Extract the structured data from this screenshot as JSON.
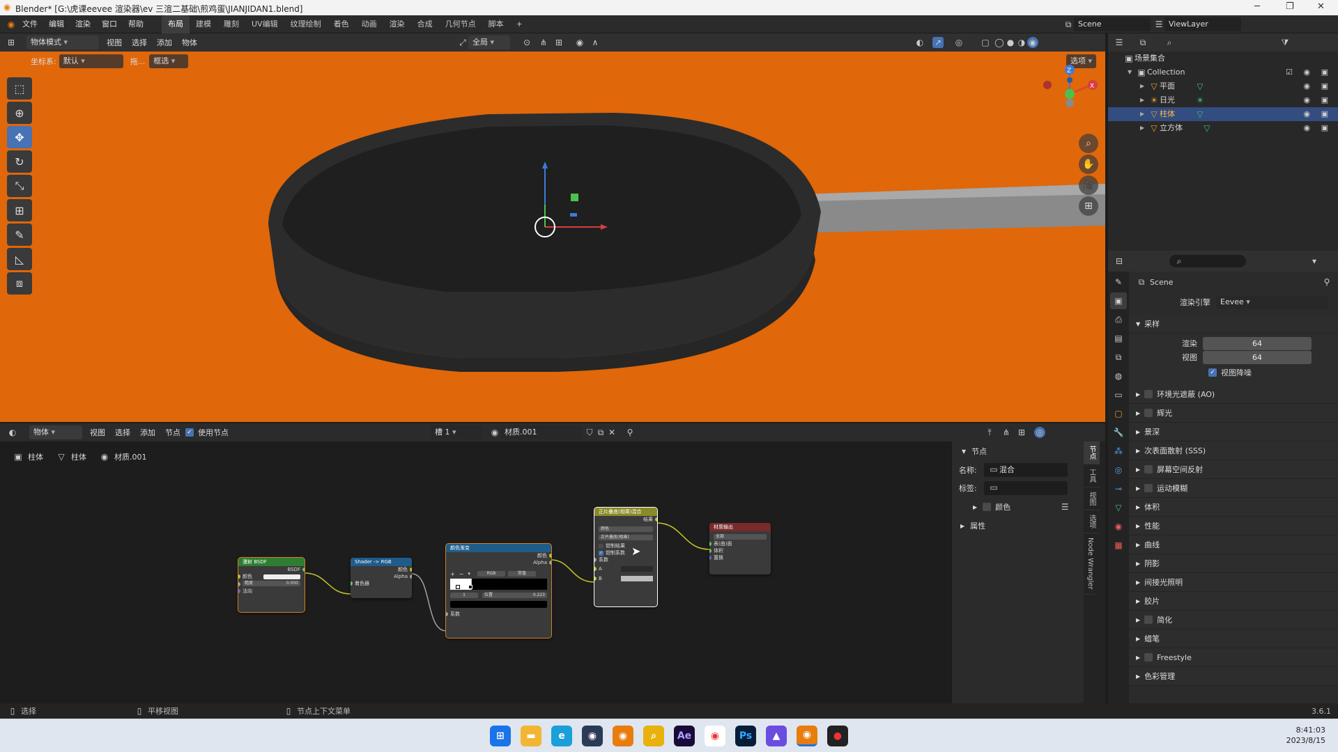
{
  "window": {
    "title": "Blender* [G:\\虎课eevee 渲染器\\ev 三渲二基础\\煎鸡蛋\\JIANJIDAN1.blend]",
    "min": "─",
    "max": "❐",
    "close": "✕"
  },
  "topbar": {
    "menus": [
      "文件",
      "编辑",
      "渲染",
      "窗口",
      "帮助"
    ],
    "workspaces": [
      "布局",
      "建模",
      "雕刻",
      "UV编辑",
      "纹理绘制",
      "着色",
      "动画",
      "渲染",
      "合成",
      "几何节点",
      "脚本"
    ],
    "active_workspace": "布局",
    "add_tab": "+",
    "scene": "Scene",
    "view_layer": "ViewLayer"
  },
  "viewport_header": {
    "mode": "物体模式",
    "menus": [
      "视图",
      "选择",
      "添加",
      "物体"
    ],
    "transform_orientation": "全局",
    "coord_label": "坐标系:",
    "coord_value": "默认",
    "drag_label": "拖...",
    "drag_value": "框选",
    "options": "选项"
  },
  "outliner": {
    "root": "场景集合",
    "collection": "Collection",
    "items": [
      {
        "name": "平面",
        "selected": false
      },
      {
        "name": "日光",
        "selected": false
      },
      {
        "name": "柱体",
        "selected": true
      },
      {
        "name": "立方体",
        "selected": false
      }
    ]
  },
  "properties": {
    "scene_name": "Scene",
    "render_engine_label": "渲染引擎",
    "render_engine": "Eevee",
    "sampling_title": "采样",
    "render_label": "渲染",
    "render_value": "64",
    "viewport_label": "视图",
    "viewport_value": "64",
    "viewport_denoise": "视图降噪",
    "panels": [
      {
        "label": "环境光遮蔽 (AO)",
        "checkbox": true
      },
      {
        "label": "辉光",
        "checkbox": true
      },
      {
        "label": "景深",
        "checkbox": false
      },
      {
        "label": "次表面散射 (SSS)",
        "checkbox": false
      },
      {
        "label": "屏幕空间反射",
        "checkbox": true
      },
      {
        "label": "运动模糊",
        "checkbox": true
      },
      {
        "label": "体积",
        "checkbox": false
      },
      {
        "label": "性能",
        "checkbox": false
      },
      {
        "label": "曲线",
        "checkbox": false
      },
      {
        "label": "阴影",
        "checkbox": false
      },
      {
        "label": "间接光照明",
        "checkbox": false
      },
      {
        "label": "胶片",
        "checkbox": false
      },
      {
        "label": "简化",
        "checkbox": true
      },
      {
        "label": "蜡笔",
        "checkbox": false
      },
      {
        "label": "Freestyle",
        "checkbox": true
      },
      {
        "label": "色彩管理",
        "checkbox": false
      }
    ]
  },
  "node_header": {
    "object_mode": "物体",
    "menus": [
      "视图",
      "选择",
      "添加",
      "节点"
    ],
    "use_nodes": "使用节点",
    "slot": "槽 1",
    "material": "材质.001"
  },
  "breadcrumb": [
    "柱体",
    "柱体",
    "材质.001"
  ],
  "n_panel": {
    "section": "节点",
    "name_label": "名称:",
    "name_value": "混合",
    "label_label": "标签:",
    "label_value": "",
    "color": "颜色",
    "properties": "属性",
    "tabs": [
      "节点",
      "工具",
      "视图",
      "选项",
      "Node Wrangler"
    ]
  },
  "nodes": {
    "diffuse": {
      "title": "漫射 BSDF",
      "out": "BSDF",
      "color": "颜色",
      "roughness": "糙度",
      "roughness_value": "0.000",
      "normal": "法向"
    },
    "s2rgb": {
      "title": "Shader -> RGB",
      "color": "颜色",
      "alpha": "Alpha",
      "shader": "着色器"
    },
    "ramp": {
      "title": "颜色渐变",
      "color": "颜色",
      "alpha": "Alpha",
      "mode": "RGB",
      "interp": "常值",
      "index": "1",
      "pos_label": "位置",
      "pos_value": "0.223",
      "fac": "系数"
    },
    "mix": {
      "title": "正片叠底(相乘)混合",
      "result": "结果",
      "type": "颜色",
      "blend": "正片叠底(相乘)",
      "clamp_result": "钳制结果",
      "clamp_factor": "钳制系数",
      "fac": "系数",
      "a": "A",
      "b": "B"
    },
    "output": {
      "title": "材质输出",
      "target": "全部",
      "surface": "表(曲)面",
      "volume": "体积",
      "displacement": "置换"
    }
  },
  "statusbar": {
    "select": "选择",
    "pan": "平移视图",
    "context": "节点上下文菜单",
    "version": "3.6.1"
  },
  "taskbar": {
    "time": "8:41:03",
    "date": "2023/8/15",
    "apps": [
      "Ae",
      "Ps"
    ]
  },
  "colors": {
    "viewport_bg": "#e0670a",
    "selected": "#334d80",
    "accent": "#4772b3"
  }
}
